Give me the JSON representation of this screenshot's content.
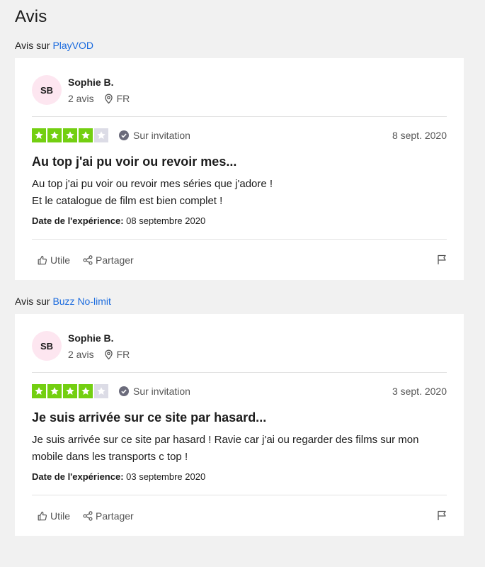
{
  "page": {
    "title": "Avis"
  },
  "reviews": [
    {
      "for_prefix": "Avis sur",
      "company": "PlayVOD",
      "user": {
        "initials": "SB",
        "name": "Sophie B.",
        "count": "2 avis",
        "country": "FR"
      },
      "rating": 4,
      "max_rating": 5,
      "verified": "Sur invitation",
      "date": "8 sept. 2020",
      "title": "Au top j'ai pu voir ou revoir mes...",
      "text": "Au top j'ai pu voir ou revoir mes séries que j'adore !\nEt le catalogue de film est bien complet !",
      "experience_label": "Date de l'expérience:",
      "experience_date": "08 septembre 2020",
      "useful_label": "Utile",
      "share_label": "Partager"
    },
    {
      "for_prefix": "Avis sur",
      "company": "Buzz No-limit",
      "user": {
        "initials": "SB",
        "name": "Sophie B.",
        "count": "2 avis",
        "country": "FR"
      },
      "rating": 4,
      "max_rating": 5,
      "verified": "Sur invitation",
      "date": "3 sept. 2020",
      "title": "Je suis arrivée sur ce site par hasard...",
      "text": "Je suis arrivée sur ce site par hasard ! Ravie car j'ai ou regarder des films sur mon mobile dans les transports c top !",
      "experience_label": "Date de l'expérience:",
      "experience_date": "03 septembre 2020",
      "useful_label": "Utile",
      "share_label": "Partager"
    }
  ],
  "colors": {
    "star_on": "#73cf11",
    "star_off": "#dcdce6",
    "link": "#1b6bde",
    "avatar_bg": "#fde6f0"
  },
  "icons": {
    "location": "location-pin-icon",
    "verified": "check-circle-icon",
    "useful": "thumbs-up-icon",
    "share": "share-icon",
    "report": "flag-icon",
    "star": "star-icon"
  }
}
